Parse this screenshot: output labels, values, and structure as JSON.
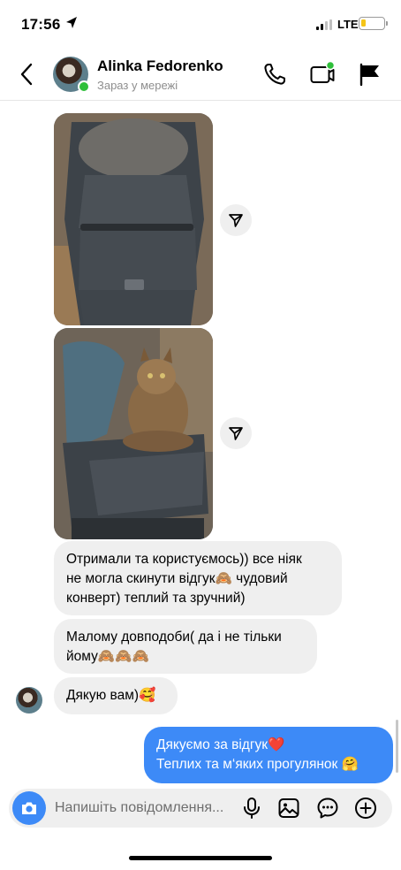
{
  "status_bar": {
    "time": "17:56",
    "network": "LTE",
    "battery_level": 0.2,
    "battery_color": "#f5c518"
  },
  "header": {
    "contact_name": "Alinka Fedorenko",
    "contact_status": "Зараз у мережі",
    "online_color": "#2fbf3a",
    "icons": [
      "back-chevron-icon",
      "phone-icon",
      "video-call-icon",
      "flag-icon"
    ]
  },
  "messages": [
    {
      "type": "image",
      "direction": "incoming",
      "icon": "share-arrow-icon"
    },
    {
      "type": "image",
      "direction": "incoming",
      "icon": "share-arrow-icon"
    },
    {
      "type": "text",
      "direction": "incoming",
      "text": "Отримали та користуємось)) все ніяк\nне могла скинути відгук🙈 чудовий\nконверт) теплий та зручний)"
    },
    {
      "type": "text",
      "direction": "incoming",
      "text": "Маломy довподоби( да і не тільки\nйому🙈🙈🙈"
    },
    {
      "type": "text",
      "direction": "incoming",
      "text": "Дякую вам)🥰"
    },
    {
      "type": "text",
      "direction": "outgoing",
      "text": "Дякуємо за відгук❤️\nТеплих та м‘яких прогулянок 🤗"
    }
  ],
  "composer": {
    "placeholder": "Напишіть повідомлення...",
    "value": "",
    "icons": [
      "camera-icon",
      "microphone-icon",
      "gallery-icon",
      "sticker-icon",
      "add-icon"
    ]
  },
  "colors": {
    "outgoing_bubble": "#3d8af7",
    "incoming_bubble": "#efefef"
  }
}
